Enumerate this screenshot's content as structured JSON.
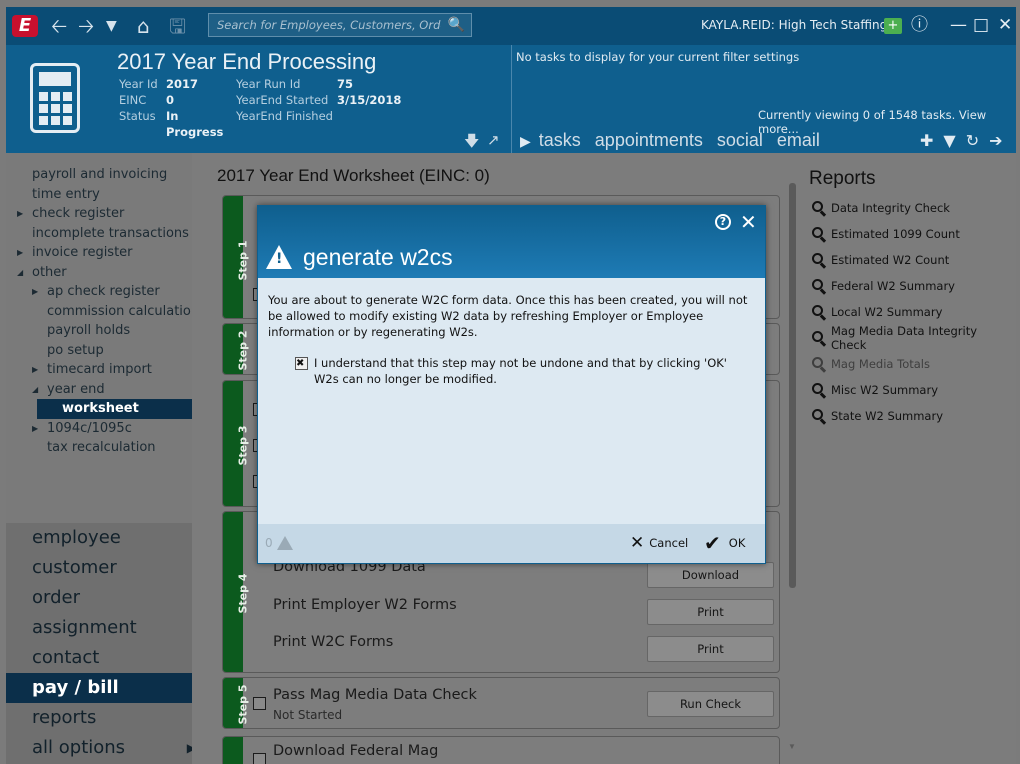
{
  "topbar": {
    "search_placeholder": "Search for Employees, Customers, Orders, etc.",
    "user": "KAYLA.REID: High Tech Staffing",
    "colors": {
      "bar": "#0a4c75",
      "logo": "#c8102e",
      "add": "#4caf50"
    }
  },
  "header": {
    "title": "2017 Year End Processing",
    "fields": [
      {
        "k": "Year Id",
        "v": "2017",
        "k2": "Year Run Id",
        "v2": "75"
      },
      {
        "k": "EINC",
        "v": "0",
        "k2": "YearEnd Started",
        "v2": "3/15/2018"
      },
      {
        "k": "Status",
        "v": "In Progress",
        "k2": "YearEnd Finished",
        "v2": ""
      }
    ],
    "no_tasks": "No tasks to display for your current filter settings",
    "viewing": "Currently viewing 0 of 1548 tasks. View more...",
    "tabs": [
      "tasks",
      "appointments",
      "social",
      "email"
    ]
  },
  "leftnav": {
    "tree": [
      {
        "label": "payroll and invoicing",
        "indent": 0,
        "arrow": ""
      },
      {
        "label": "time entry",
        "indent": 0,
        "arrow": ""
      },
      {
        "label": "check register",
        "indent": 0,
        "arrow": "right"
      },
      {
        "label": "incomplete transactions",
        "indent": 0,
        "arrow": ""
      },
      {
        "label": "invoice register",
        "indent": 0,
        "arrow": "right"
      },
      {
        "label": "other",
        "indent": 0,
        "arrow": "down"
      },
      {
        "label": "ap check register",
        "indent": 1,
        "arrow": "right"
      },
      {
        "label": "commission calculation",
        "indent": 1,
        "arrow": ""
      },
      {
        "label": "payroll holds",
        "indent": 1,
        "arrow": ""
      },
      {
        "label": "po setup",
        "indent": 1,
        "arrow": ""
      },
      {
        "label": "timecard import",
        "indent": 1,
        "arrow": "right"
      },
      {
        "label": "year end",
        "indent": 1,
        "arrow": "down"
      },
      {
        "label": "worksheet",
        "indent": 2,
        "arrow": "",
        "selected": true
      },
      {
        "label": "1094c/1095c",
        "indent": 1,
        "arrow": "right"
      },
      {
        "label": "tax recalculation",
        "indent": 1,
        "arrow": ""
      }
    ],
    "main": [
      {
        "label": "employee"
      },
      {
        "label": "customer"
      },
      {
        "label": "order"
      },
      {
        "label": "assignment"
      },
      {
        "label": "contact"
      },
      {
        "label": "pay / bill",
        "selected": true
      },
      {
        "label": "reports"
      },
      {
        "label": "all options",
        "arrow": true
      }
    ]
  },
  "main": {
    "title": "2017 Year End Worksheet (EINC: 0)",
    "steps": [
      {
        "label": "Step 1",
        "rows": []
      },
      {
        "label": "Step 2",
        "rows": []
      },
      {
        "label": "Step 3",
        "rows": []
      },
      {
        "label": "Step 4",
        "rows": [
          {
            "text": "Download 1099 Data",
            "button": "Download"
          },
          {
            "text": "Print Employer W2 Forms",
            "button": "Print"
          },
          {
            "text": "Print W2C Forms",
            "button": "Print"
          }
        ]
      },
      {
        "label": "Step 5",
        "rows": [
          {
            "text": "Pass Mag Media Data Check",
            "status": "Not Started",
            "button": "Run Check"
          }
        ]
      },
      {
        "label": "",
        "rows": [
          {
            "text": "Download Federal Mag"
          }
        ]
      }
    ]
  },
  "reports": {
    "title": "Reports",
    "items": [
      {
        "label": "Data Integrity Check"
      },
      {
        "label": "Estimated 1099 Count"
      },
      {
        "label": "Estimated W2 Count"
      },
      {
        "label": "Federal W2 Summary"
      },
      {
        "label": "Local W2 Summary"
      },
      {
        "label": "Mag Media Data Integrity Check"
      },
      {
        "label": "Mag Media Totals",
        "disabled": true
      },
      {
        "label": "Misc W2 Summary"
      },
      {
        "label": "State W2 Summary"
      }
    ]
  },
  "modal": {
    "title": "generate w2cs",
    "body": "You are about to generate W2C form data. Once this has been created, you will not be allowed to modify existing W2 data by refreshing Employer or Employee information or by regenerating W2s.",
    "agree": "I understand that this step may not be undone and that by clicking 'OK' W2s can no longer be modified.",
    "warning_count": "0",
    "cancel": "Cancel",
    "ok": "OK"
  }
}
